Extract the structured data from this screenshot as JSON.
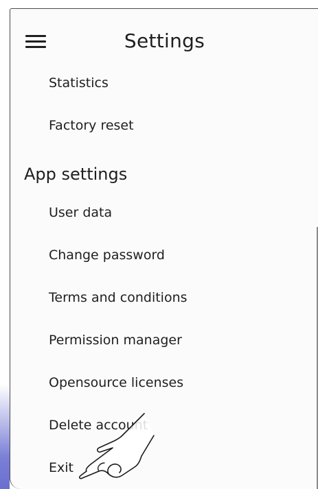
{
  "header": {
    "title": "Settings",
    "menu_icon": "hamburger-menu-icon"
  },
  "top_items": [
    {
      "label": "Statistics"
    },
    {
      "label": "Factory reset"
    }
  ],
  "app_settings": {
    "section_title": "App settings",
    "items": [
      {
        "label": "User data"
      },
      {
        "label": "Change password"
      },
      {
        "label": "Terms and conditions"
      },
      {
        "label": "Permission manager"
      },
      {
        "label": "Opensource licenses"
      },
      {
        "label": "Delete account"
      },
      {
        "label": "Exit"
      }
    ]
  },
  "overlay": {
    "gesture_icon": "tap-hand-icon"
  },
  "colors": {
    "panel_background": "#fbfbfb",
    "text": "#1e1e1e",
    "accent_edge": "#7b7fd6"
  }
}
